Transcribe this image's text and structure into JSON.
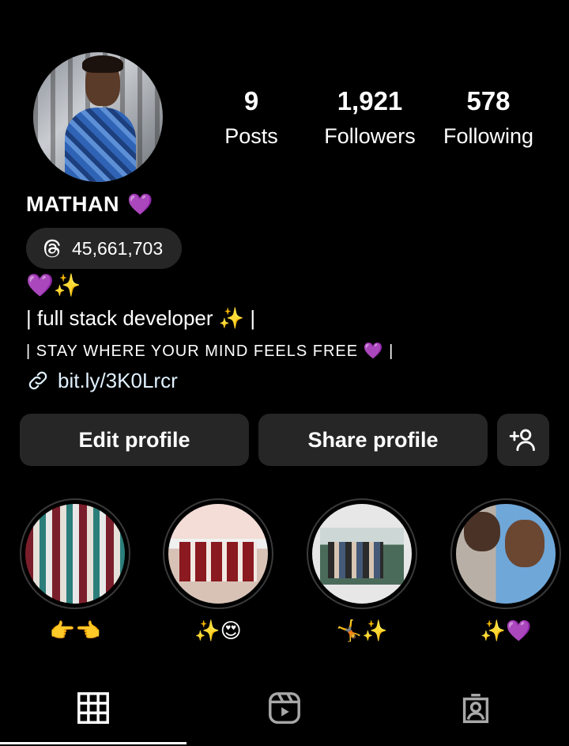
{
  "profile": {
    "name": "MATHAN",
    "name_emoji": "💜",
    "stats": {
      "posts_count": "9",
      "posts_label": "Posts",
      "followers_count": "1,921",
      "followers_label": "Followers",
      "following_count": "578",
      "following_label": "Following"
    },
    "threads_count": "45,661,703",
    "bio": {
      "emoji_line": "💜✨",
      "line1": "| full stack developer ✨ |",
      "line2": "| STAY WHERE YOUR MIND FEELS FREE 💜 |",
      "link": "bit.ly/3K0Lrcr"
    }
  },
  "actions": {
    "edit_label": "Edit profile",
    "share_label": "Share profile",
    "add_person_icon": "add-person-icon"
  },
  "highlights": [
    {
      "label": "👉👈"
    },
    {
      "label": "✨😍"
    },
    {
      "label": "🤸✨"
    },
    {
      "label": "✨💜"
    }
  ],
  "tabs": [
    {
      "icon": "grid-icon",
      "active": true
    },
    {
      "icon": "reels-icon",
      "active": false
    },
    {
      "icon": "tagged-icon",
      "active": false
    }
  ],
  "colors": {
    "background": "#000000",
    "button_bg": "#262626",
    "text": "#ffffff"
  }
}
